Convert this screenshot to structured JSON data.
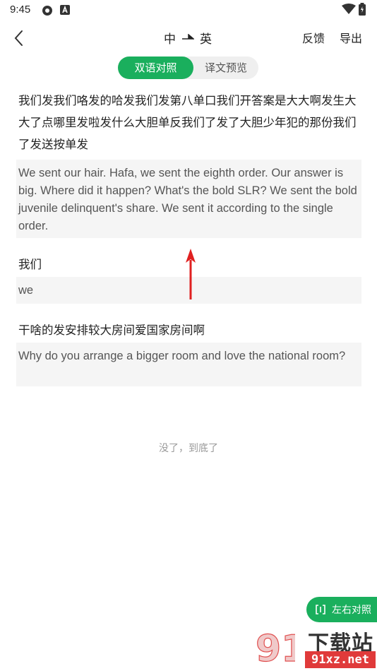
{
  "status_bar": {
    "time": "9:45",
    "icons": [
      "gear-icon",
      "notification-a-icon",
      "wifi-icon",
      "battery-icon"
    ]
  },
  "header": {
    "back_icon": "chevron-left-icon",
    "source_lang": "中",
    "target_lang": "英",
    "feedback_label": "反馈",
    "export_label": "导出"
  },
  "tabs": [
    {
      "label": "双语对照",
      "active": true
    },
    {
      "label": "译文预览",
      "active": false
    }
  ],
  "segments": [
    {
      "source": "我们发我们咯发的哈发我们发第八单口我们开答案是大大啊发生大大了点哪里发啦发什么大胆单反我们了发了大胆少年犯的那份我们了发送按单发",
      "translation": "We sent our hair. Hafa, we sent the eighth order. Our answer is big. Where did it happen? What's the bold SLR? We sent the bold juvenile delinquent's share. We sent it according to the single order."
    },
    {
      "source": "我们",
      "translation": "we"
    },
    {
      "source": "干啥的发安排较大房间爱国家房间啊",
      "translation": "Why do you arrange a bigger room and love the national room?"
    }
  ],
  "end_note": "没了，到底了",
  "float_button": {
    "label": "左右对照",
    "icon": "side-by-side-icon"
  },
  "watermark": {
    "text": "下载站",
    "domain": "91xz.net"
  },
  "colors": {
    "accent": "#1aaf5d",
    "annotation_arrow": "#e02020"
  }
}
